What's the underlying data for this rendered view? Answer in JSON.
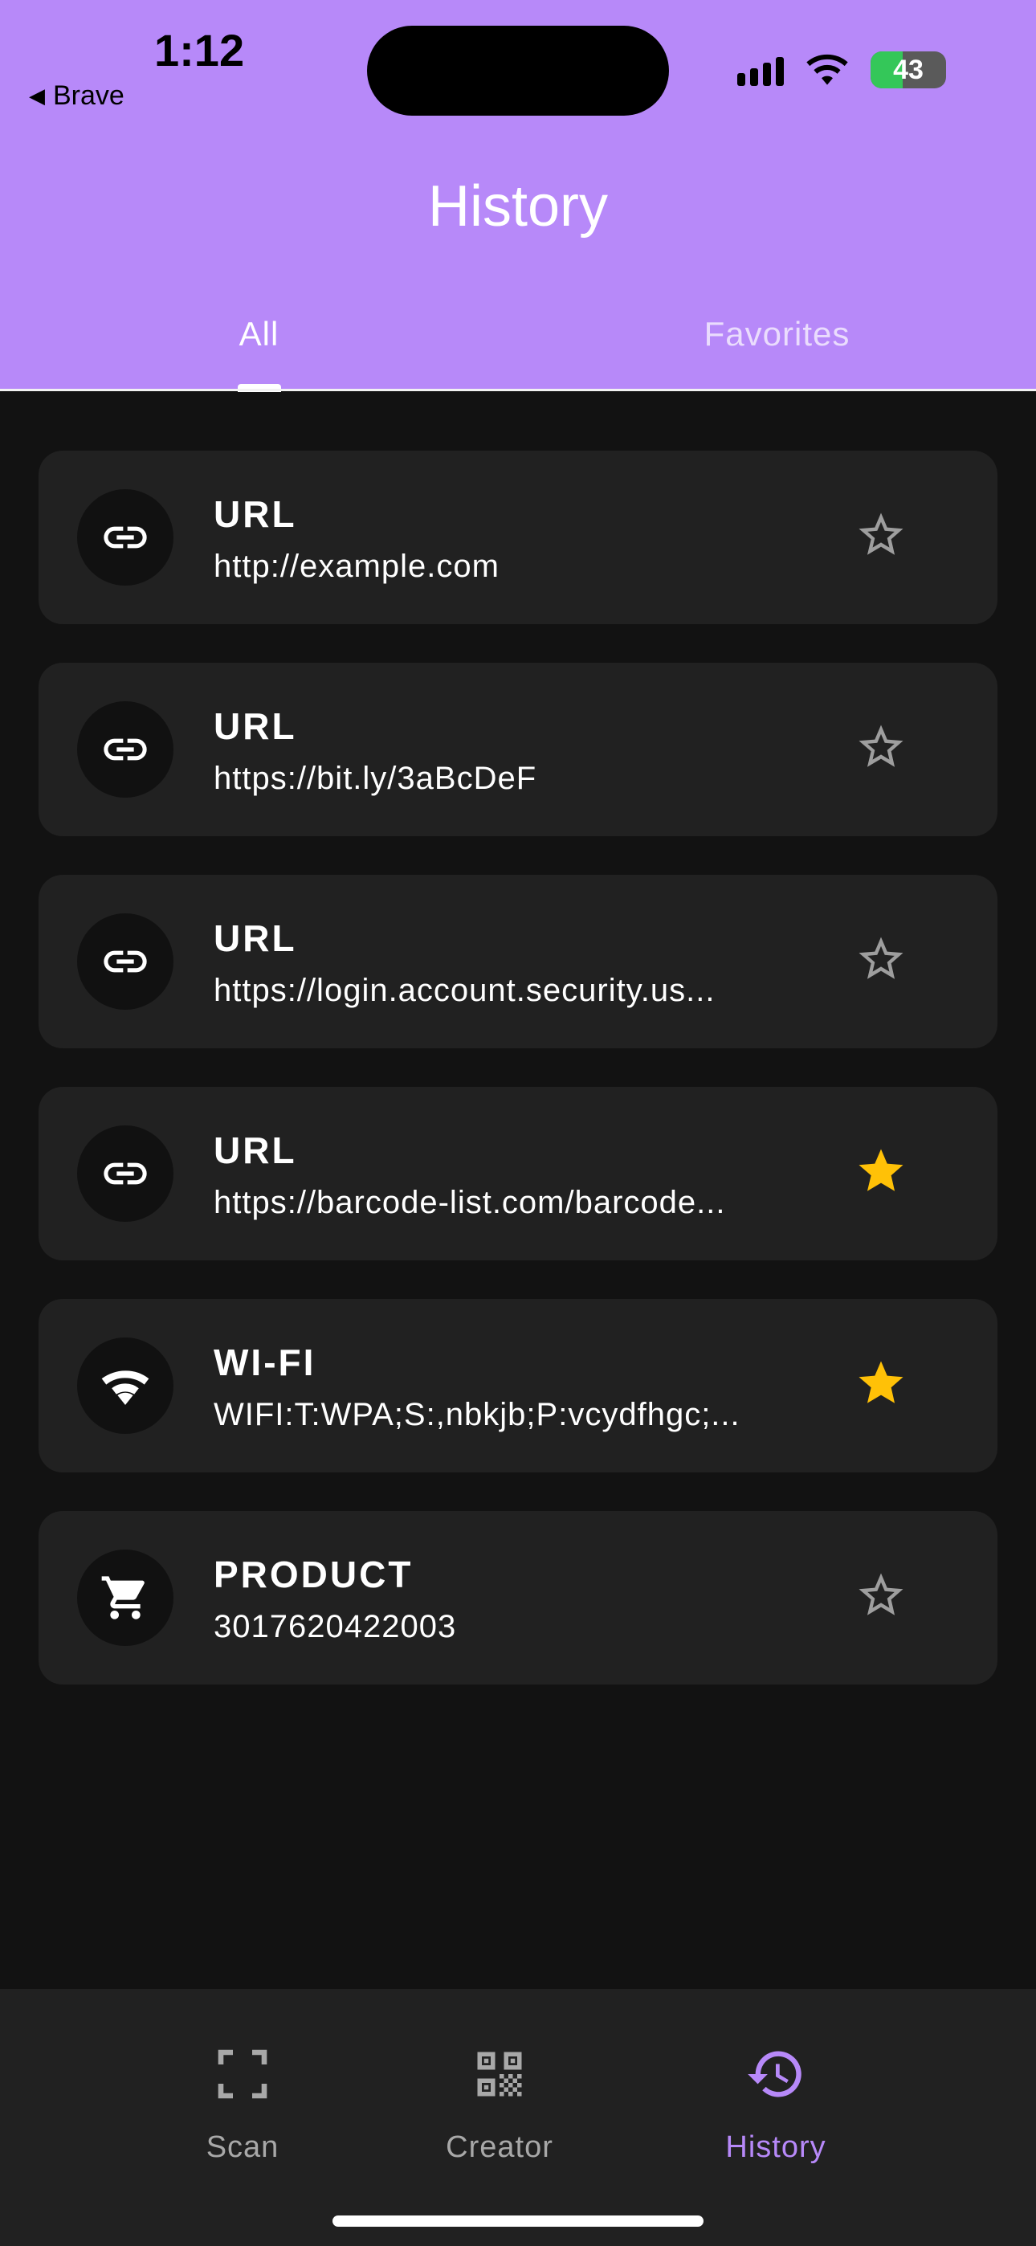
{
  "status_bar": {
    "time": "1:12",
    "back_app": "Brave",
    "battery": "43",
    "battery_level": 0.43
  },
  "header": {
    "title": "History",
    "tabs": [
      {
        "label": "All",
        "active": true
      },
      {
        "label": "Favorites",
        "active": false
      }
    ]
  },
  "items": [
    {
      "icon": "link-icon",
      "type": "URL",
      "value": "http://example.com",
      "favorite": false
    },
    {
      "icon": "link-icon",
      "type": "URL",
      "value": "https://bit.ly/3aBcDeF",
      "favorite": false
    },
    {
      "icon": "link-icon",
      "type": "URL",
      "value": "https://login.account.security.us...",
      "favorite": false
    },
    {
      "icon": "link-icon",
      "type": "URL",
      "value": "https://barcode-list.com/barcode...",
      "favorite": true
    },
    {
      "icon": "wifi-icon",
      "type": "WI-FI",
      "value": "WIFI:T:WPA;S:,nbkjb;P:vcydfhgc;...",
      "favorite": true
    },
    {
      "icon": "cart-icon",
      "type": "PRODUCT",
      "value": "3017620422003",
      "favorite": false
    }
  ],
  "bottom_nav": {
    "items": [
      {
        "label": "Scan",
        "icon": "scan-icon",
        "active": false
      },
      {
        "label": "Creator",
        "icon": "qr-code-icon",
        "active": false
      },
      {
        "label": "History",
        "icon": "history-icon",
        "active": true
      }
    ]
  },
  "colors": {
    "accent": "#b789f9",
    "background": "#121212",
    "card": "#212121",
    "star_active": "#ffc107",
    "star_inactive": "#9e9e9e"
  }
}
